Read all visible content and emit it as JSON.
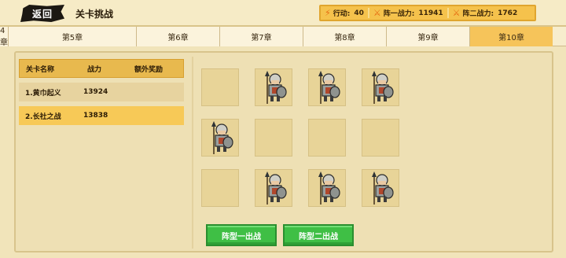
{
  "header": {
    "back_label": "返回",
    "title": "关卡挑战",
    "stats": [
      {
        "label": "行动:",
        "value": "40",
        "icon": "lightning-icon"
      },
      {
        "label": "阵一战力:",
        "value": "11941",
        "icon": "crossed-swords-icon"
      },
      {
        "label": "阵二战力:",
        "value": "1762",
        "icon": "crossed-swords-icon"
      }
    ]
  },
  "tabs": {
    "items": [
      "4章",
      "第5章",
      "第6章",
      "第7章",
      "第8章",
      "第9章",
      "第10章"
    ],
    "active_index": 6
  },
  "stage_list": {
    "headers": {
      "name": "关卡名称",
      "power": "战力",
      "reward": "额外奖励"
    },
    "rows": [
      {
        "name": "1.黄巾起义",
        "power": "13924",
        "reward": ""
      },
      {
        "name": "2.长社之战",
        "power": "13838",
        "reward": ""
      }
    ],
    "selected_index": 1
  },
  "formation": {
    "rows": 3,
    "cols": 4,
    "occupied": [
      [
        false,
        true,
        true,
        true
      ],
      [
        true,
        false,
        false,
        false
      ],
      [
        false,
        true,
        true,
        true
      ]
    ],
    "unit_icon": "spearman-soldier-icon"
  },
  "buttons": {
    "battle_one": "阵型一出战",
    "battle_two": "阵型二出战"
  },
  "colors": {
    "background": "#f1e4ba",
    "accent_gold": "#f5c24c",
    "active_tab": "#f6c45a",
    "button_green": "#3fbf45"
  }
}
